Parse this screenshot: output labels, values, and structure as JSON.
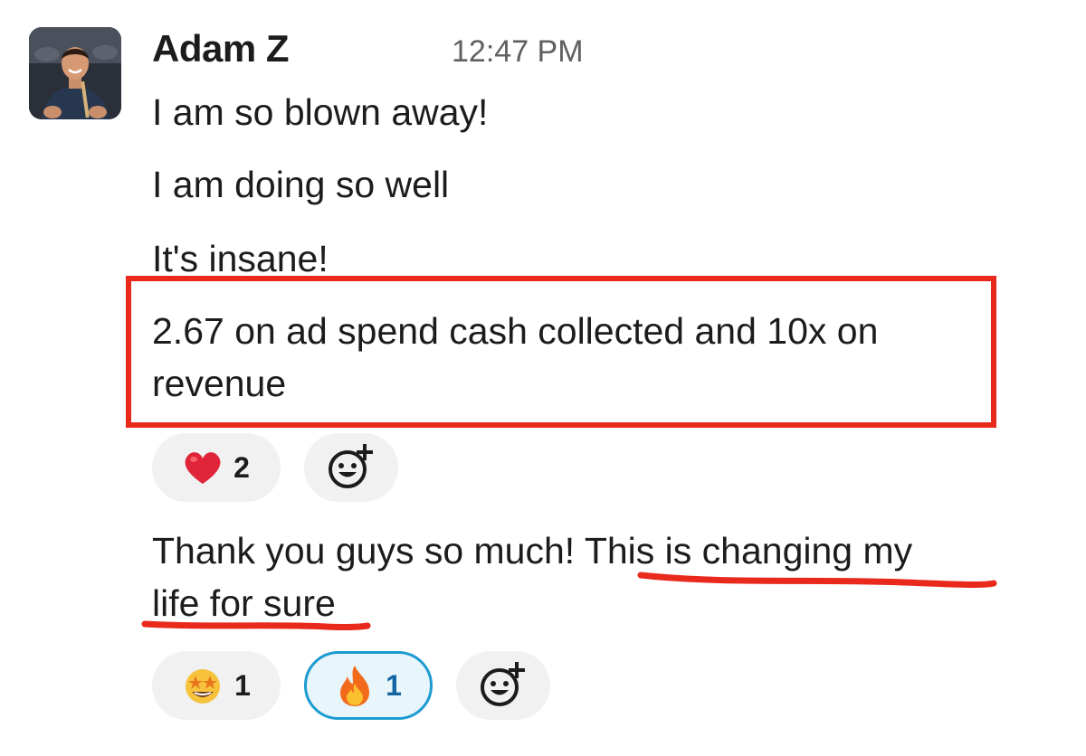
{
  "message": {
    "sender": "Adam Z",
    "timestamp": "12:47 PM",
    "lines": [
      "I am so blown away!",
      "I am doing so well",
      "It's insane!"
    ],
    "highlighted_text": "2.67 on ad spend cash collected and 10x on revenue",
    "reactions_1": [
      {
        "emoji": "heart",
        "count": "2"
      }
    ],
    "followup_plain": "Thank you guys so much! ",
    "followup_underlined_1": "This is changing my",
    "followup_underlined_2": "life for sure",
    "reactions_2": [
      {
        "emoji": "star-struck",
        "count": "1"
      },
      {
        "emoji": "fire",
        "count": "1"
      }
    ]
  },
  "colors": {
    "annotation_red": "#e8291c",
    "active_reaction_border": "#1d9bd1",
    "active_reaction_bg": "#e8f5fa",
    "reaction_bg": "#f1f1f1"
  },
  "icons": {
    "add_reaction": "add-reaction-icon"
  }
}
